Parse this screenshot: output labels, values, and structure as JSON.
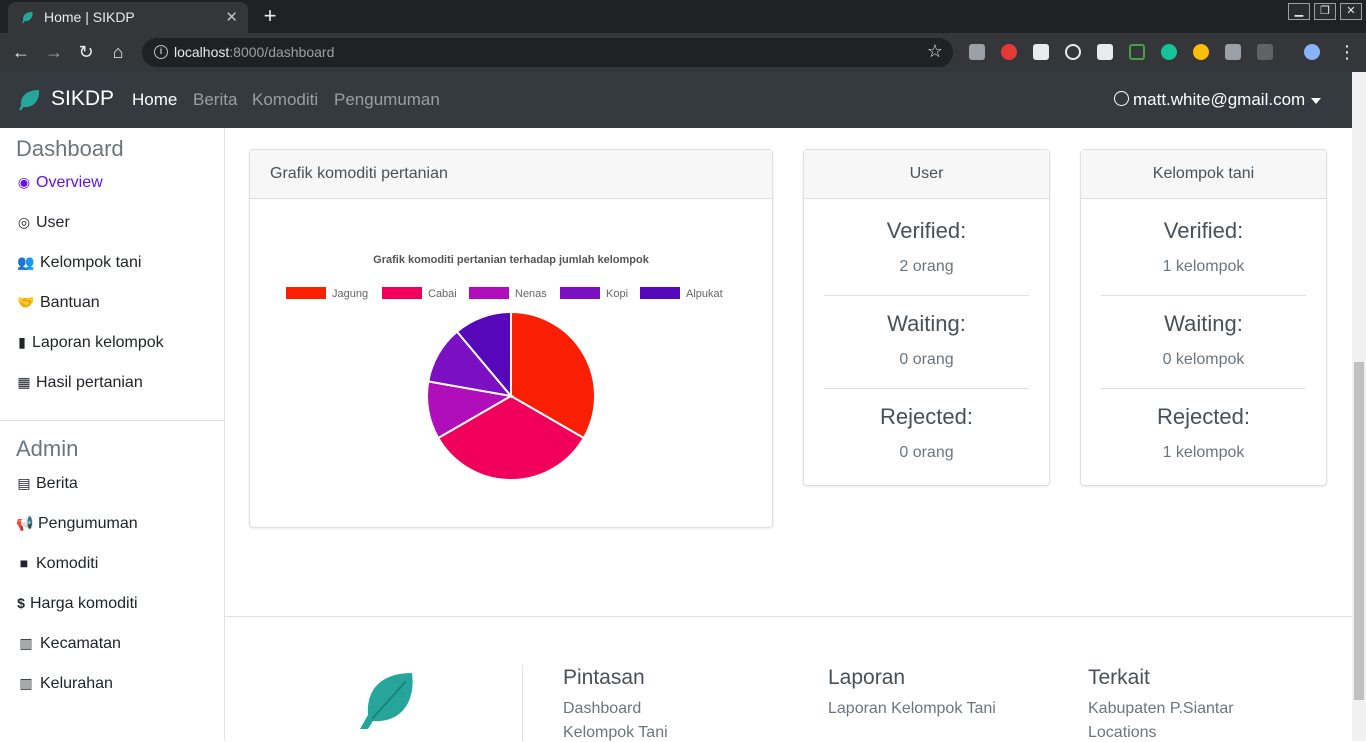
{
  "browser": {
    "tab_title": "Home | SIKDP",
    "url_host": "localhost",
    "url_path": ":8000/dashboard"
  },
  "navbar": {
    "brand": "SIKDP",
    "links": [
      "Home",
      "Berita",
      "Komoditi",
      "Pengumuman"
    ],
    "user_email": "matt.white@gmail.com"
  },
  "sidebar": {
    "dashboard_heading": "Dashboard",
    "dashboard_items": [
      {
        "label": "Overview",
        "icon": "dot-circle-icon"
      },
      {
        "label": "User",
        "icon": "user-circle-icon"
      },
      {
        "label": "Kelompok tani",
        "icon": "users-icon"
      },
      {
        "label": "Bantuan",
        "icon": "hands-helping-icon"
      },
      {
        "label": "Laporan kelompok",
        "icon": "file-icon"
      },
      {
        "label": "Hasil pertanian",
        "icon": "cubes-icon"
      }
    ],
    "admin_heading": "Admin",
    "admin_items": [
      {
        "label": "Berita",
        "icon": "newspaper-icon"
      },
      {
        "label": "Pengumuman",
        "icon": "bullhorn-icon"
      },
      {
        "label": "Komoditi",
        "icon": "box-icon"
      },
      {
        "label": "Harga komoditi",
        "icon": "dollar-icon"
      },
      {
        "label": "Kecamatan",
        "icon": "city-icon"
      },
      {
        "label": "Kelurahan",
        "icon": "city-icon"
      }
    ]
  },
  "chart_card": {
    "header": "Grafik komoditi pertanian"
  },
  "chart_data": {
    "type": "pie",
    "title": "Grafik komoditi pertanian terhadap jumlah kelompok",
    "categories": [
      "Jagung",
      "Cabai",
      "Nenas",
      "Kopi",
      "Alpukat"
    ],
    "values": [
      33.3,
      33.3,
      11.1,
      11.1,
      11.1
    ],
    "colors": [
      "#fa1e02",
      "#f0005a",
      "#b00dbb",
      "#7b0fc2",
      "#5507b9"
    ],
    "legend_position": "top"
  },
  "user_card": {
    "header": "User",
    "stats": [
      {
        "label": "Verified:",
        "value": "2 orang"
      },
      {
        "label": "Waiting:",
        "value": "0 orang"
      },
      {
        "label": "Rejected:",
        "value": "0 orang"
      }
    ]
  },
  "kelompok_card": {
    "header": "Kelompok tani",
    "stats": [
      {
        "label": "Verified:",
        "value": "1 kelompok"
      },
      {
        "label": "Waiting:",
        "value": "0 kelompok"
      },
      {
        "label": "Rejected:",
        "value": "1 kelompok"
      }
    ]
  },
  "footer": {
    "pintasan": {
      "heading": "Pintasan",
      "links": [
        "Dashboard",
        "Kelompok Tani"
      ]
    },
    "laporan": {
      "heading": "Laporan",
      "links": [
        "Laporan Kelompok Tani"
      ]
    },
    "terkait": {
      "heading": "Terkait",
      "links": [
        "Kabupaten P.Siantar",
        "Locations"
      ]
    }
  },
  "colors": {
    "navbar_bg": "#343a40",
    "accent": "#6610f2",
    "brand_leaf": "#26a69a"
  }
}
